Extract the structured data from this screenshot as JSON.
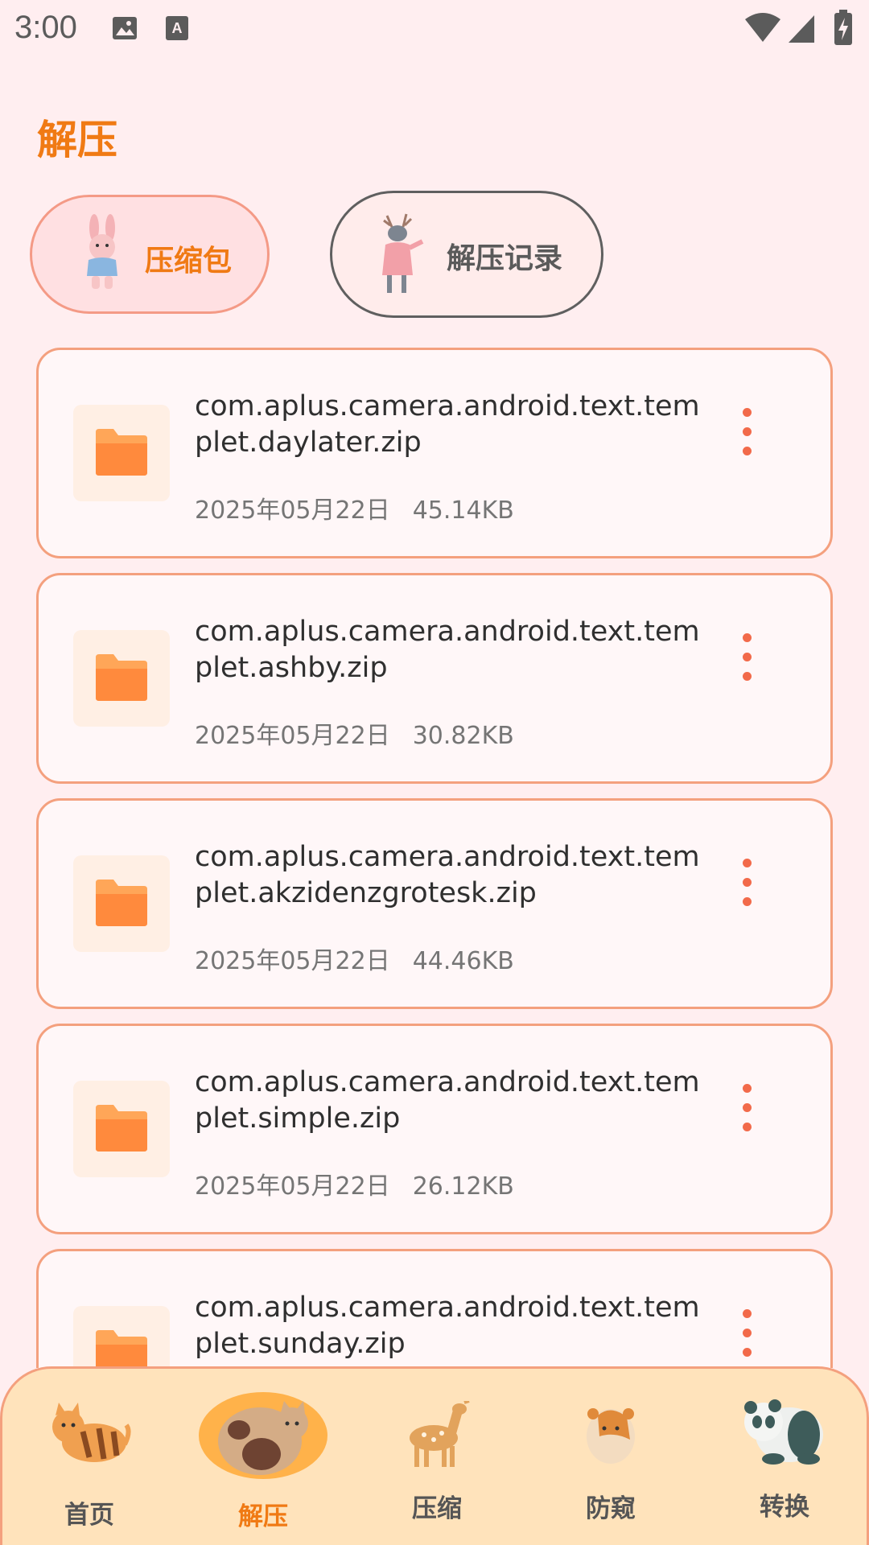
{
  "status_bar": {
    "time": "3:00",
    "icons": [
      "image-icon",
      "keyboard-a-icon",
      "wifi-icon",
      "signal-icon",
      "battery-charging-icon"
    ]
  },
  "header": {
    "title": "解压"
  },
  "tabs": [
    {
      "label": "压缩包",
      "active": true,
      "icon": "rabbit-icon"
    },
    {
      "label": "解压记录",
      "active": false,
      "icon": "deer-icon"
    }
  ],
  "files": [
    {
      "name": "com.aplus.camera.android.text.templet.daylater.zip",
      "date": "2025年05月22日",
      "size": "45.14KB"
    },
    {
      "name": "com.aplus.camera.android.text.templet.ashby.zip",
      "date": "2025年05月22日",
      "size": "30.82KB"
    },
    {
      "name": "com.aplus.camera.android.text.templet.akzidenzgrotesk.zip",
      "date": "2025年05月22日",
      "size": "44.46KB"
    },
    {
      "name": "com.aplus.camera.android.text.templet.simple.zip",
      "date": "2025年05月22日",
      "size": "26.12KB"
    },
    {
      "name": "com.aplus.camera.android.text.templet.sunday.zip",
      "date": "",
      "size": ""
    }
  ],
  "bottom_nav": [
    {
      "label": "首页",
      "icon": "tabby-cat-icon",
      "active": false
    },
    {
      "label": "解压",
      "icon": "fat-cat-icon",
      "active": true
    },
    {
      "label": "压缩",
      "icon": "fawn-icon",
      "active": false
    },
    {
      "label": "防窥",
      "icon": "hamster-icon",
      "active": false
    },
    {
      "label": "转换",
      "icon": "panda-icon",
      "active": false
    }
  ],
  "colors": {
    "background": "#ffeef0",
    "accent": "#f07a14",
    "card_border": "#f4a07e",
    "nav_background": "#ffe3bb",
    "more_dots": "#f26a4a"
  }
}
